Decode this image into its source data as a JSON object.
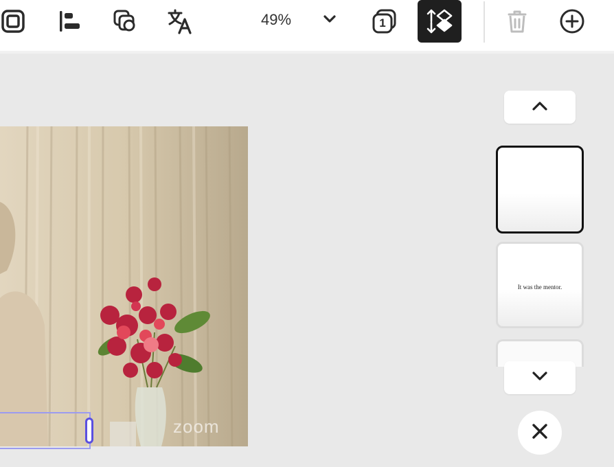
{
  "toolbar": {
    "icons": [
      "frame-icon",
      "align-left-icon",
      "duplicate-icon",
      "translate-icon",
      "layers-count-icon",
      "reorder-icon",
      "trash-icon",
      "add-icon"
    ],
    "zoom_value": "49%",
    "layer_count": "1",
    "accent_color": "#1f1f1f"
  },
  "canvas": {
    "watermark": "zoom"
  },
  "pages_panel": {
    "thumbnails": [
      {
        "text": "",
        "selected": true
      },
      {
        "text": "It was the mentor.",
        "selected": false
      },
      {
        "text": "",
        "selected": false
      }
    ],
    "scroll_up_icon": "chevron-up-icon",
    "scroll_down_icon": "chevron-down-icon",
    "close_icon": "close-icon"
  }
}
